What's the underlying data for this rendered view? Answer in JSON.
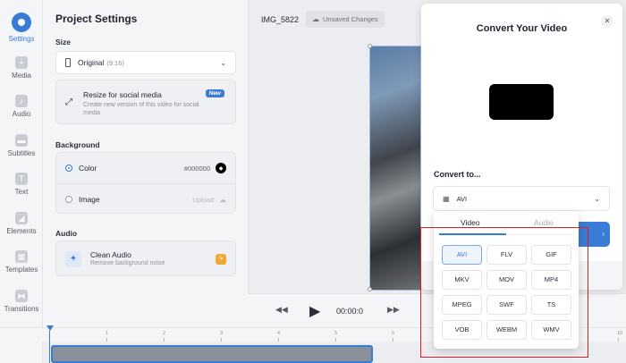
{
  "rail": {
    "items": [
      {
        "label": "Settings",
        "active": true
      },
      {
        "label": "Media"
      },
      {
        "label": "Audio"
      },
      {
        "label": "Subtitles"
      },
      {
        "label": "Text"
      },
      {
        "label": "Elements"
      },
      {
        "label": "Templates"
      },
      {
        "label": "Transitions"
      }
    ]
  },
  "panel": {
    "title": "Project Settings",
    "size_label": "Size",
    "size_value": "Original",
    "size_ratio": "(9:16)",
    "resize_title": "Resize for social media",
    "resize_desc": "Create new version of this video for social media",
    "new_badge": "New",
    "background_label": "Background",
    "color_label": "Color",
    "color_value": "#000000",
    "image_label": "Image",
    "upload_label": "Upload",
    "audio_label": "Audio",
    "clean_audio_title": "Clean Audio",
    "clean_audio_desc": "Remove background noise"
  },
  "topbar": {
    "file_name": "IMG_5822",
    "unsaved": "Unsaved Changes"
  },
  "player": {
    "timecode": "00:00:0"
  },
  "ruler_ticks": [
    "1",
    "2",
    "3",
    "4",
    "5",
    "6",
    "7",
    "8",
    "9",
    "10"
  ],
  "modal": {
    "title": "Convert Your Video",
    "convert_to": "Convert to...",
    "selected_format": "AVI"
  },
  "dropdown": {
    "tabs": [
      "Video",
      "Audio"
    ],
    "formats": [
      "AVI",
      "FLV",
      "GIF",
      "MKV",
      "MOV",
      "MP4",
      "MPEG",
      "SWF",
      "TS",
      "VOB",
      "WEBM",
      "WMV"
    ],
    "selected": "AVI"
  },
  "colors": {
    "accent": "#3a7bd5",
    "highlight": "#e02020"
  }
}
